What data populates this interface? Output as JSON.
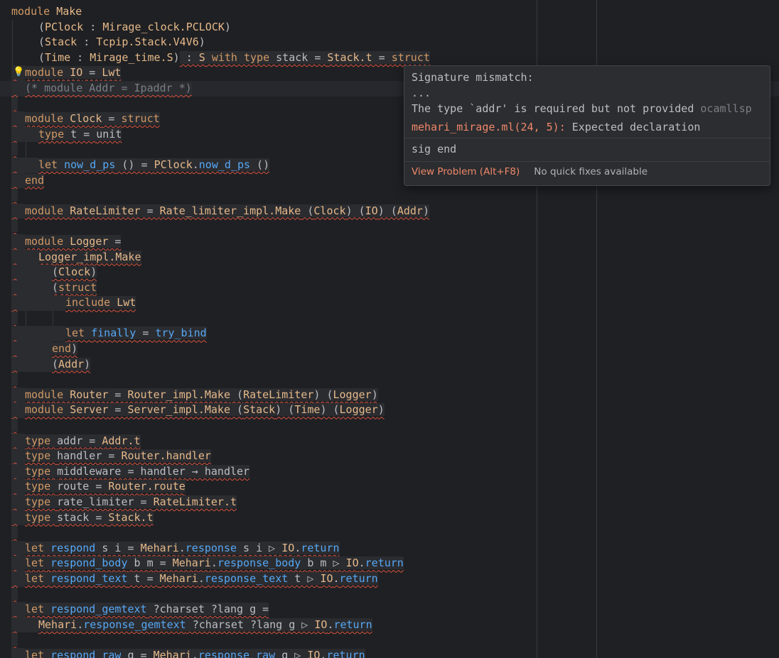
{
  "editor": {
    "lines": [
      {
        "indent": 0,
        "error": false,
        "segments": [
          {
            "k": "kw",
            "t": "module "
          },
          {
            "k": "mod",
            "t": "Make"
          }
        ]
      },
      {
        "indent": 2,
        "error": false,
        "segments": [
          {
            "k": "pn",
            "t": "("
          },
          {
            "k": "mod",
            "t": "PClock"
          },
          {
            "k": "pn",
            "t": " : "
          },
          {
            "k": "mod",
            "t": "Mirage_clock.PCLOCK"
          },
          {
            "k": "pn",
            "t": ")"
          }
        ]
      },
      {
        "indent": 2,
        "error": false,
        "segments": [
          {
            "k": "pn",
            "t": "("
          },
          {
            "k": "mod",
            "t": "Stack"
          },
          {
            "k": "pn",
            "t": " : "
          },
          {
            "k": "mod",
            "t": "Tcpip.Stack.V4V6"
          },
          {
            "k": "pn",
            "t": ")"
          }
        ]
      },
      {
        "indent": 2,
        "error": false,
        "segments": [
          {
            "k": "pn",
            "t": "("
          },
          {
            "k": "mod",
            "t": "Time"
          },
          {
            "k": "pn",
            "t": " : "
          },
          {
            "k": "mod",
            "t": "Mirage_time.S"
          },
          {
            "k": "pn",
            "t": ")"
          },
          {
            "k": "pn",
            "t": " : ",
            "e": true
          },
          {
            "k": "mod",
            "t": "S",
            "e": true
          },
          {
            "k": "kw",
            "t": " with type ",
            "e": true
          },
          {
            "k": "pn",
            "t": "stack = ",
            "e": true
          },
          {
            "k": "mod",
            "t": "Stack.t",
            "e": true
          },
          {
            "k": "pn",
            "t": " = ",
            "e": true
          },
          {
            "k": "kw",
            "t": "struct",
            "e": true
          }
        ]
      },
      {
        "indent": 1,
        "error": true,
        "segments": [
          {
            "k": "kw",
            "t": "module "
          },
          {
            "k": "mod",
            "t": "IO"
          },
          {
            "k": "pn",
            "t": " = "
          },
          {
            "k": "mod",
            "t": "Lwt"
          }
        ]
      },
      {
        "indent": 1,
        "error": true,
        "current": true,
        "caret_after": 0,
        "segments": [
          {
            "k": "cm",
            "t": "(* module Addr = Ipaddr"
          },
          {
            "k": "cm",
            "t": " *)"
          }
        ]
      },
      {
        "indent": 0,
        "error": true,
        "segments": [
          {
            "k": "pn",
            "t": " "
          }
        ]
      },
      {
        "indent": 1,
        "error": true,
        "segments": [
          {
            "k": "kw",
            "t": "module "
          },
          {
            "k": "mod",
            "t": "Clock"
          },
          {
            "k": "pn",
            "t": " = "
          },
          {
            "k": "kw",
            "t": "struct"
          }
        ]
      },
      {
        "indent": 2,
        "error": true,
        "segments": [
          {
            "k": "kw",
            "t": "type "
          },
          {
            "k": "pn",
            "t": "t = "
          },
          {
            "k": "pn",
            "t": "unit"
          }
        ]
      },
      {
        "indent": 0,
        "error": true,
        "segments": [
          {
            "k": "pn",
            "t": " "
          }
        ]
      },
      {
        "indent": 2,
        "error": true,
        "segments": [
          {
            "k": "kw",
            "t": "let "
          },
          {
            "k": "fn",
            "t": "now_d_ps"
          },
          {
            "k": "pn",
            "t": " () = "
          },
          {
            "k": "mod",
            "t": "PClock"
          },
          {
            "k": "pn",
            "t": "."
          },
          {
            "k": "fn",
            "t": "now_d_ps"
          },
          {
            "k": "pn",
            "t": " ()"
          }
        ]
      },
      {
        "indent": 1,
        "error": true,
        "segments": [
          {
            "k": "kw",
            "t": "end"
          }
        ]
      },
      {
        "indent": 0,
        "error": true,
        "segments": [
          {
            "k": "pn",
            "t": " "
          }
        ]
      },
      {
        "indent": 1,
        "error": true,
        "segments": [
          {
            "k": "kw",
            "t": "module "
          },
          {
            "k": "mod",
            "t": "RateLimiter"
          },
          {
            "k": "pn",
            "t": " = "
          },
          {
            "k": "mod",
            "t": "Rate_limiter_impl.Make"
          },
          {
            "k": "pn",
            "t": " ("
          },
          {
            "k": "mod",
            "t": "Clock"
          },
          {
            "k": "pn",
            "t": ") ("
          },
          {
            "k": "mod",
            "t": "IO"
          },
          {
            "k": "pn",
            "t": ") ("
          },
          {
            "k": "mod",
            "t": "Addr"
          },
          {
            "k": "pn",
            "t": ")"
          }
        ]
      },
      {
        "indent": 0,
        "error": true,
        "segments": [
          {
            "k": "pn",
            "t": " "
          }
        ]
      },
      {
        "indent": 1,
        "error": true,
        "segments": [
          {
            "k": "kw",
            "t": "module "
          },
          {
            "k": "mod",
            "t": "Logger"
          },
          {
            "k": "pn",
            "t": " ="
          }
        ]
      },
      {
        "indent": 2,
        "error": true,
        "segments": [
          {
            "k": "mod",
            "t": "Logger_impl.Make"
          }
        ]
      },
      {
        "indent": 3,
        "error": true,
        "segments": [
          {
            "k": "pn",
            "t": "("
          },
          {
            "k": "mod",
            "t": "Clock"
          },
          {
            "k": "pn",
            "t": ")"
          }
        ]
      },
      {
        "indent": 3,
        "error": true,
        "segments": [
          {
            "k": "pn",
            "t": "("
          },
          {
            "k": "kw",
            "t": "struct"
          }
        ]
      },
      {
        "indent": 4,
        "error": true,
        "segments": [
          {
            "k": "kw",
            "t": "include "
          },
          {
            "k": "mod",
            "t": "Lwt"
          }
        ]
      },
      {
        "indent": 0,
        "error": true,
        "segments": [
          {
            "k": "pn",
            "t": " "
          }
        ]
      },
      {
        "indent": 4,
        "error": true,
        "segments": [
          {
            "k": "kw",
            "t": "let "
          },
          {
            "k": "fn",
            "t": "finally"
          },
          {
            "k": "pn",
            "t": " = "
          },
          {
            "k": "fn",
            "t": "try_bind"
          }
        ]
      },
      {
        "indent": 3,
        "error": true,
        "segments": [
          {
            "k": "kw",
            "t": "end"
          },
          {
            "k": "pn",
            "t": ")"
          }
        ]
      },
      {
        "indent": 3,
        "error": true,
        "segments": [
          {
            "k": "pn",
            "t": "("
          },
          {
            "k": "mod",
            "t": "Addr"
          },
          {
            "k": "pn",
            "t": ")"
          }
        ]
      },
      {
        "indent": 0,
        "error": true,
        "segments": [
          {
            "k": "pn",
            "t": " "
          }
        ]
      },
      {
        "indent": 1,
        "error": true,
        "segments": [
          {
            "k": "kw",
            "t": "module "
          },
          {
            "k": "mod",
            "t": "Router"
          },
          {
            "k": "pn",
            "t": " = "
          },
          {
            "k": "mod",
            "t": "Router_impl.Make"
          },
          {
            "k": "pn",
            "t": " ("
          },
          {
            "k": "mod",
            "t": "RateLimiter"
          },
          {
            "k": "pn",
            "t": ") ("
          },
          {
            "k": "mod",
            "t": "Logger"
          },
          {
            "k": "pn",
            "t": ")"
          }
        ]
      },
      {
        "indent": 1,
        "error": true,
        "segments": [
          {
            "k": "kw",
            "t": "module "
          },
          {
            "k": "mod",
            "t": "Server"
          },
          {
            "k": "pn",
            "t": " = "
          },
          {
            "k": "mod",
            "t": "Server_impl.Make"
          },
          {
            "k": "pn",
            "t": " ("
          },
          {
            "k": "mod",
            "t": "Stack"
          },
          {
            "k": "pn",
            "t": ") ("
          },
          {
            "k": "mod",
            "t": "Time"
          },
          {
            "k": "pn",
            "t": ") ("
          },
          {
            "k": "mod",
            "t": "Logger"
          },
          {
            "k": "pn",
            "t": ")"
          }
        ]
      },
      {
        "indent": 0,
        "error": true,
        "segments": [
          {
            "k": "pn",
            "t": " "
          }
        ]
      },
      {
        "indent": 1,
        "error": true,
        "segments": [
          {
            "k": "kw",
            "t": "type "
          },
          {
            "k": "pn",
            "t": "addr = "
          },
          {
            "k": "mod",
            "t": "Addr.t"
          }
        ]
      },
      {
        "indent": 1,
        "error": true,
        "segments": [
          {
            "k": "kw",
            "t": "type "
          },
          {
            "k": "pn",
            "t": "handler = "
          },
          {
            "k": "mod",
            "t": "Router.handler"
          }
        ]
      },
      {
        "indent": 1,
        "error": true,
        "segments": [
          {
            "k": "kw",
            "t": "type "
          },
          {
            "k": "pn",
            "t": "middleware = handler → handler"
          }
        ]
      },
      {
        "indent": 1,
        "error": true,
        "segments": [
          {
            "k": "kw",
            "t": "type "
          },
          {
            "k": "pn",
            "t": "route = "
          },
          {
            "k": "mod",
            "t": "Router.route"
          }
        ]
      },
      {
        "indent": 1,
        "error": true,
        "segments": [
          {
            "k": "kw",
            "t": "type "
          },
          {
            "k": "pn",
            "t": "rate_limiter = "
          },
          {
            "k": "mod",
            "t": "RateLimiter.t"
          }
        ]
      },
      {
        "indent": 1,
        "error": true,
        "segments": [
          {
            "k": "kw",
            "t": "type "
          },
          {
            "k": "pn",
            "t": "stack = "
          },
          {
            "k": "mod",
            "t": "Stack.t"
          }
        ]
      },
      {
        "indent": 0,
        "error": true,
        "segments": [
          {
            "k": "pn",
            "t": " "
          }
        ]
      },
      {
        "indent": 1,
        "error": true,
        "segments": [
          {
            "k": "kw",
            "t": "let "
          },
          {
            "k": "fn",
            "t": "respond"
          },
          {
            "k": "pn",
            "t": " s i = "
          },
          {
            "k": "mod",
            "t": "Mehari"
          },
          {
            "k": "pn",
            "t": "."
          },
          {
            "k": "fn",
            "t": "response"
          },
          {
            "k": "pn",
            "t": " s i ▷ "
          },
          {
            "k": "mod",
            "t": "IO"
          },
          {
            "k": "pn",
            "t": "."
          },
          {
            "k": "fn",
            "t": "return"
          }
        ]
      },
      {
        "indent": 1,
        "error": true,
        "segments": [
          {
            "k": "kw",
            "t": "let "
          },
          {
            "k": "fn",
            "t": "respond_body"
          },
          {
            "k": "pn",
            "t": " b m = "
          },
          {
            "k": "mod",
            "t": "Mehari"
          },
          {
            "k": "pn",
            "t": "."
          },
          {
            "k": "fn",
            "t": "response_body"
          },
          {
            "k": "pn",
            "t": " b m ▷ "
          },
          {
            "k": "mod",
            "t": "IO"
          },
          {
            "k": "pn",
            "t": "."
          },
          {
            "k": "fn",
            "t": "return"
          }
        ]
      },
      {
        "indent": 1,
        "error": true,
        "segments": [
          {
            "k": "kw",
            "t": "let "
          },
          {
            "k": "fn",
            "t": "respond_text"
          },
          {
            "k": "pn",
            "t": " t = "
          },
          {
            "k": "mod",
            "t": "Mehari"
          },
          {
            "k": "pn",
            "t": "."
          },
          {
            "k": "fn",
            "t": "response_text"
          },
          {
            "k": "pn",
            "t": " t ▷ "
          },
          {
            "k": "mod",
            "t": "IO"
          },
          {
            "k": "pn",
            "t": "."
          },
          {
            "k": "fn",
            "t": "return"
          }
        ]
      },
      {
        "indent": 0,
        "error": true,
        "segments": [
          {
            "k": "pn",
            "t": " "
          }
        ]
      },
      {
        "indent": 1,
        "error": true,
        "segments": [
          {
            "k": "kw",
            "t": "let "
          },
          {
            "k": "fn",
            "t": "respond_gemtext"
          },
          {
            "k": "pn",
            "t": " ?charset ?lang g ="
          }
        ]
      },
      {
        "indent": 2,
        "error": true,
        "segments": [
          {
            "k": "mod",
            "t": "Mehari"
          },
          {
            "k": "pn",
            "t": "."
          },
          {
            "k": "fn",
            "t": "response_gemtext"
          },
          {
            "k": "pn",
            "t": " ?charset ?lang g ▷ "
          },
          {
            "k": "mod",
            "t": "IO"
          },
          {
            "k": "pn",
            "t": "."
          },
          {
            "k": "fn",
            "t": "return"
          }
        ]
      },
      {
        "indent": 0,
        "error": true,
        "segments": [
          {
            "k": "pn",
            "t": " "
          }
        ]
      },
      {
        "indent": 1,
        "error": true,
        "segments": [
          {
            "k": "kw",
            "t": "let "
          },
          {
            "k": "fn",
            "t": "respond_raw"
          },
          {
            "k": "pn",
            "t": " g = "
          },
          {
            "k": "mod",
            "t": "Mehari"
          },
          {
            "k": "pn",
            "t": "."
          },
          {
            "k": "fn",
            "t": "response_raw"
          },
          {
            "k": "pn",
            "t": " g ▷ "
          },
          {
            "k": "mod",
            "t": "IO"
          },
          {
            "k": "pn",
            "t": "."
          },
          {
            "k": "fn",
            "t": "return"
          }
        ]
      }
    ]
  },
  "popup": {
    "title": "Signature mismatch:",
    "ellipsis": "...",
    "message": "The type `addr' is required but not provided",
    "source": "ocamllsp",
    "location": "mehari_mirage.ml(24, 5):",
    "location_text": "Expected declaration",
    "signature": "sig end",
    "view_problem": "View Problem (Alt+F8)",
    "no_fixes": "No quick fixes available"
  },
  "colors": {
    "background": "#1f2023",
    "error_underline": "#d9533f",
    "keyword": "#d19a66",
    "function": "#56a8f5"
  },
  "icons": {
    "quick_fix": "lightbulb-icon"
  }
}
